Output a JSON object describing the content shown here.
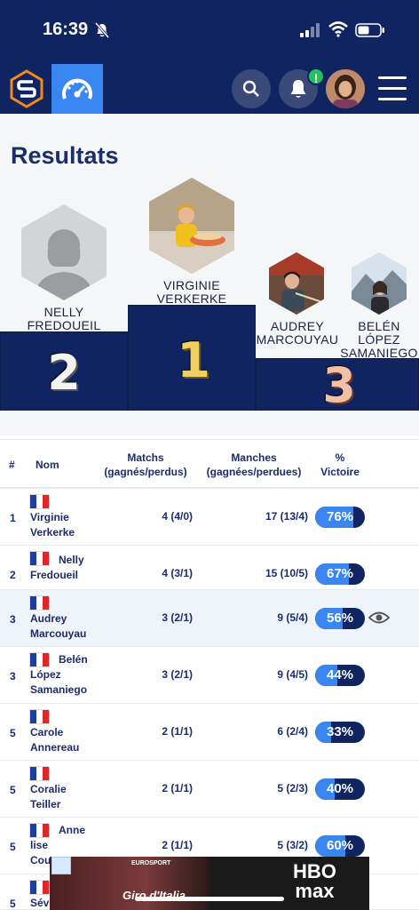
{
  "status": {
    "time": "16:39"
  },
  "header": {
    "notification_badge": "!"
  },
  "page": {
    "title": "Resultats"
  },
  "podium": [
    {
      "place": "2",
      "name": "NELLY\nFREDOUEIL"
    },
    {
      "place": "1",
      "name": "VIRGINIE\nVERKERKE"
    },
    {
      "place": "3",
      "name": "AUDREY\nMARCOUYAU"
    },
    {
      "place": "3",
      "name": "BELÉN\nLÓPEZ\nSAMANIEGO"
    }
  ],
  "table": {
    "headers": {
      "rank": "#",
      "name": "Nom",
      "matchs": "Matchs\n(gagnés/perdus)",
      "manches": "Manches\n(gagnées/perdues)",
      "pct": "%\nVictoire"
    },
    "rows": [
      {
        "rank": "1",
        "name": "Virginie\nVerkerke",
        "matchs": "4 (4/0)",
        "manches": "17 (13/4)",
        "pct": "76%",
        "pct_value": 0.76,
        "highlight": false
      },
      {
        "rank": "2",
        "name": "Nelly\nFredoueil",
        "matchs": "4 (3/1)",
        "manches": "15 (10/5)",
        "pct": "67%",
        "pct_value": 0.67,
        "highlight": false
      },
      {
        "rank": "3",
        "name": "Audrey\nMarcouyau",
        "matchs": "3 (2/1)",
        "manches": "9 (5/4)",
        "pct": "56%",
        "pct_value": 0.56,
        "highlight": true
      },
      {
        "rank": "3",
        "name": "Belén\nLópez\nSamaniego",
        "matchs": "3 (2/1)",
        "manches": "9 (4/5)",
        "pct": "44%",
        "pct_value": 0.44,
        "highlight": false
      },
      {
        "rank": "5",
        "name": "Carole\nAnnereau",
        "matchs": "2 (1/1)",
        "manches": "6 (2/4)",
        "pct": "33%",
        "pct_value": 0.33,
        "highlight": false
      },
      {
        "rank": "5",
        "name": "Coralie\nTeiller",
        "matchs": "2 (1/1)",
        "manches": "5 (2/3)",
        "pct": "40%",
        "pct_value": 0.4,
        "highlight": false
      },
      {
        "rank": "5",
        "name": "Anne\nlise\nCoust",
        "matchs": "2 (1/1)",
        "manches": "5 (3/2)",
        "pct": "60%",
        "pct_value": 0.6,
        "highlight": false
      },
      {
        "rank": "5",
        "name": "Sév",
        "matchs": "",
        "manches": "",
        "pct": "",
        "pct_value": 0,
        "highlight": false
      }
    ]
  },
  "ad": {
    "line1": "EUROSPORT",
    "line2": "Giro d'Italia",
    "brand": "HBO\nmax"
  },
  "colors": {
    "navy": "#0f2460",
    "accent": "#3a86f0",
    "flag_blue": "#1f3d9a",
    "flag_red": "#e2252b"
  }
}
